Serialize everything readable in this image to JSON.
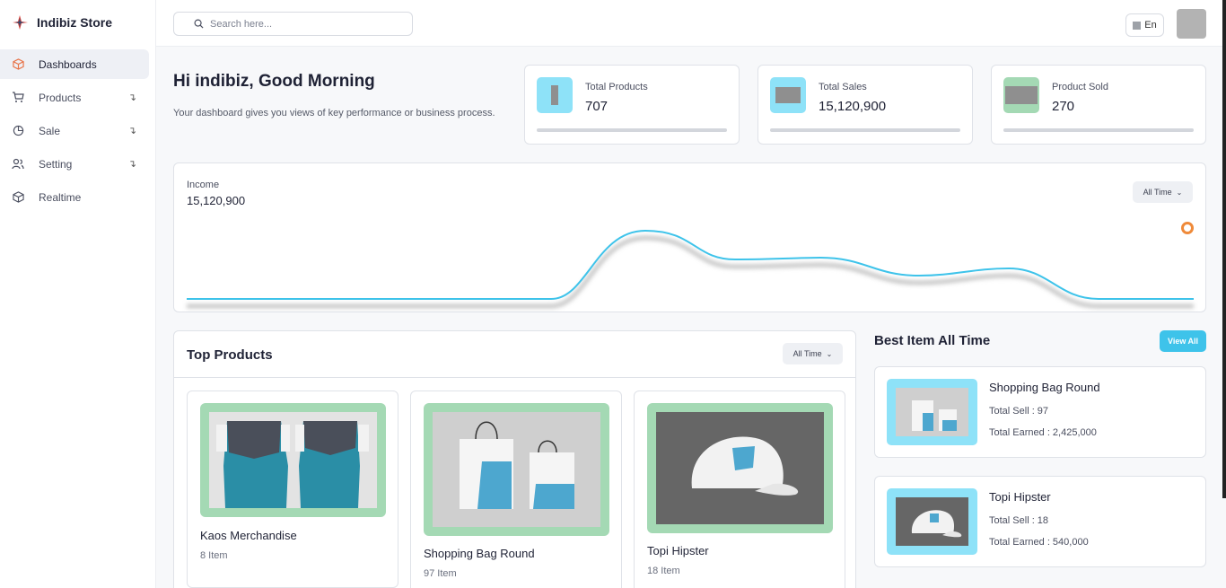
{
  "brand": {
    "name": "Indibiz Store"
  },
  "sidebar": {
    "items": [
      {
        "label": "Dashboards",
        "icon": "cube-icon",
        "active": true
      },
      {
        "label": "Products",
        "icon": "cart-icon",
        "expandable": true
      },
      {
        "label": "Sale",
        "icon": "pie-chart-icon",
        "expandable": true
      },
      {
        "label": "Setting",
        "icon": "users-icon",
        "expandable": true
      },
      {
        "label": "Realtime",
        "icon": "box-icon"
      }
    ]
  },
  "header": {
    "search_placeholder": "Search here...",
    "language": "En"
  },
  "greeting": {
    "title": "Hi indibiz, Good Morning",
    "subtitle": "Your dashboard gives you views of key performance or business process."
  },
  "stats": [
    {
      "label": "Total Products",
      "value": "707",
      "color": "#8ee2f8"
    },
    {
      "label": "Total Sales",
      "value": "15,120,900",
      "color": "#8ee2f8"
    },
    {
      "label": "Product Sold",
      "value": "270",
      "color": "#a4d9b4"
    }
  ],
  "income": {
    "label": "Income",
    "value": "15,120,900",
    "filter": "All Time",
    "line_color": "#3ec3ea"
  },
  "top_products": {
    "title": "Top Products",
    "filter": "All Time",
    "items": [
      {
        "name": "Kaos Merchandise",
        "count": "8 Item"
      },
      {
        "name": "Shopping Bag Round",
        "count": "97 Item"
      },
      {
        "name": "Topi Hipster",
        "count": "18 Item"
      }
    ]
  },
  "best_items": {
    "title": "Best Item All Time",
    "view_all": "View All",
    "items": [
      {
        "name": "Shopping Bag Round",
        "total_sell": "Total Sell : 97",
        "total_earned": "Total Earned : 2,425,000"
      },
      {
        "name": "Topi Hipster",
        "total_sell": "Total Sell : 18",
        "total_earned": "Total Earned : 540,000"
      }
    ]
  }
}
